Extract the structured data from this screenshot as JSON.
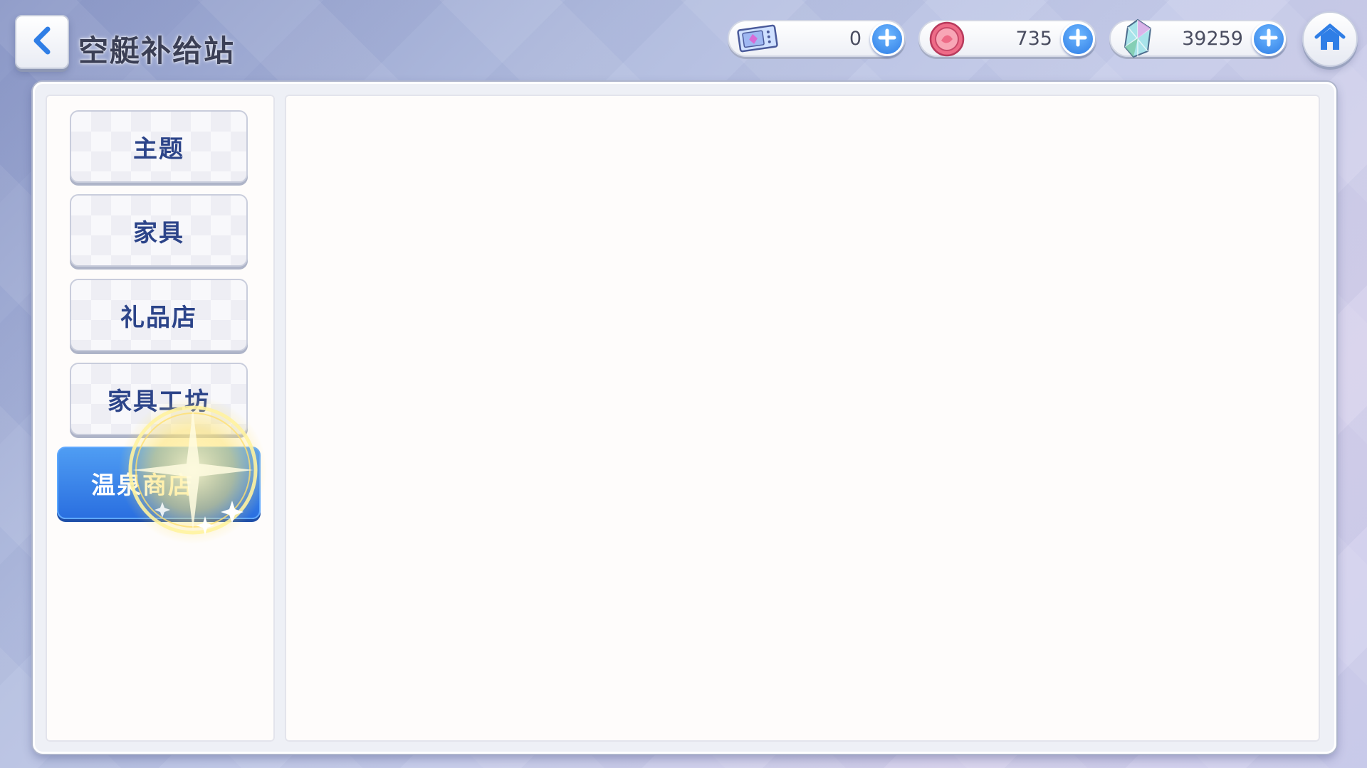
{
  "header": {
    "title": "空艇补给站",
    "back_icon": "chevron-left-icon",
    "home_icon": "home-icon"
  },
  "currencies": [
    {
      "name": "ticket",
      "icon": "ticket-icon",
      "amount": "0"
    },
    {
      "name": "coin",
      "icon": "coin-icon",
      "amount": "735"
    },
    {
      "name": "gem",
      "icon": "gem-icon",
      "amount": "39259"
    }
  ],
  "sidebar": {
    "tabs": [
      {
        "label": "主题",
        "active": false
      },
      {
        "label": "家具",
        "active": false
      },
      {
        "label": "礼品店",
        "active": false
      },
      {
        "label": "家具工坊",
        "active": false
      },
      {
        "label": "温泉商店",
        "active": true
      }
    ]
  },
  "colors": {
    "accent_blue": "#2f7ee6",
    "tab_text": "#2c4489",
    "active_tab": "#3a86ea",
    "sparkle": "#ffe36a"
  }
}
